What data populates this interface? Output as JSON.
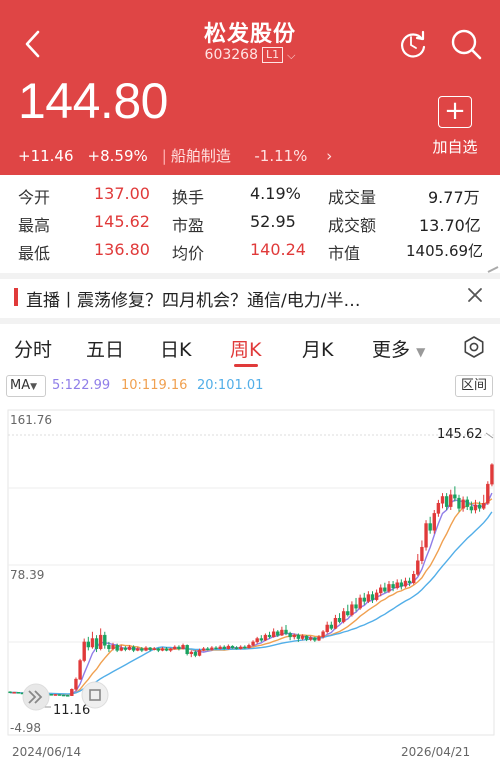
{
  "header": {
    "name": "松发股份",
    "code": "603268",
    "level": "L1",
    "price": "144.80",
    "change": "+11.46",
    "change_pct": "+8.59%",
    "sector": "船舶制造",
    "sector_change": "-1.11%",
    "add_fav_label": "加自选"
  },
  "stats": {
    "rows": [
      [
        {
          "l": "今开",
          "v": "137.00"
        },
        {
          "l": "换手",
          "v": "4.19%"
        },
        {
          "l": "成交量",
          "v": "9.77万"
        }
      ],
      [
        {
          "l": "最高",
          "v": "145.62"
        },
        {
          "l": "市盈",
          "v": "52.95"
        },
        {
          "l": "成交额",
          "v": "13.70亿"
        }
      ],
      [
        {
          "l": "最低",
          "v": "136.80"
        },
        {
          "l": "均价",
          "v": "140.24"
        },
        {
          "l": "市值",
          "v": "1405.69亿"
        }
      ]
    ]
  },
  "news": {
    "text": "直播丨震荡修复？四月机会？通信/电力/半…"
  },
  "tabs": [
    "分时",
    "五日",
    "日K",
    "周K",
    "月K",
    "更多"
  ],
  "active_tab": "周K",
  "ma": {
    "label": "MA",
    "ma5": "5:122.99",
    "ma10": "10:119.16",
    "ma20": "20:101.01",
    "range_label": "区间"
  },
  "colors": {
    "brand": "#df4545",
    "up": "#e03a3a",
    "down": "#1aa260",
    "ma5": "#8f7ee8",
    "ma10": "#f0a050",
    "ma20": "#52aee8"
  },
  "chart_data": {
    "type": "candlestick",
    "y_top_label": "161.76",
    "y_mid_label": "78.39",
    "y_bottom_label": "-4.98",
    "ylim": [
      -4.98,
      161.76
    ],
    "high_label": "145.62",
    "low_label": "11.16",
    "x_start": "2024/06/14",
    "x_end": "2026/04/21",
    "candles": [
      [
        10.5,
        10.0,
        10.8,
        9.9
      ],
      [
        10.0,
        10.2,
        10.4,
        9.8
      ],
      [
        10.2,
        9.8,
        10.3,
        9.6
      ],
      [
        9.8,
        9.5,
        10.0,
        9.3
      ],
      [
        9.5,
        9.9,
        10.0,
        9.4
      ],
      [
        9.9,
        9.6,
        10.1,
        9.4
      ],
      [
        9.6,
        9.2,
        9.8,
        9.0
      ],
      [
        9.2,
        9.4,
        9.6,
        9.0
      ],
      [
        9.4,
        9.1,
        9.6,
        8.9
      ],
      [
        9.1,
        9.0,
        9.3,
        8.8
      ],
      [
        9.0,
        8.7,
        9.2,
        8.4
      ],
      [
        8.7,
        8.9,
        9.1,
        8.5
      ],
      [
        8.9,
        8.6,
        9.0,
        8.3
      ],
      [
        8.6,
        8.4,
        8.8,
        8.1
      ],
      [
        8.4,
        8.2,
        8.7,
        8.0
      ],
      [
        8.2,
        12.0,
        12.5,
        8.1
      ],
      [
        12.0,
        18.0,
        19.0,
        11.16
      ],
      [
        18.0,
        29.0,
        30.0,
        17.5
      ],
      [
        29.0,
        40.0,
        42.0,
        28.0
      ],
      [
        40.0,
        37.0,
        43.0,
        35.0
      ],
      [
        37.0,
        42.0,
        46.0,
        36.0
      ],
      [
        42.0,
        36.0,
        44.0,
        34.0
      ],
      [
        36.0,
        44.0,
        48.0,
        35.0
      ],
      [
        44.0,
        38.0,
        46.0,
        36.0
      ],
      [
        38.0,
        36.0,
        40.0,
        34.0
      ],
      [
        36.0,
        38.0,
        39.5,
        35.0
      ],
      [
        38.0,
        35.0,
        39.0,
        34.0
      ],
      [
        35.0,
        36.5,
        38.0,
        34.5
      ],
      [
        36.5,
        35.5,
        37.5,
        34.5
      ],
      [
        35.5,
        37.0,
        38.0,
        35.0
      ],
      [
        37.0,
        35.0,
        38.0,
        34.0
      ],
      [
        35.0,
        36.0,
        37.0,
        34.5
      ],
      [
        36.0,
        35.0,
        37.0,
        34.0
      ],
      [
        35.0,
        36.5,
        37.5,
        34.5
      ],
      [
        36.5,
        35.5,
        37.0,
        34.5
      ],
      [
        35.5,
        36.0,
        37.0,
        35.0
      ],
      [
        36.0,
        35.0,
        36.5,
        34.0
      ],
      [
        35.0,
        36.0,
        37.0,
        34.5
      ],
      [
        36.0,
        35.0,
        37.0,
        34.5
      ],
      [
        35.0,
        36.0,
        36.5,
        34.0
      ],
      [
        36.0,
        37.0,
        38.0,
        35.5
      ],
      [
        37.0,
        36.0,
        38.0,
        35.0
      ],
      [
        36.0,
        38.0,
        39.0,
        35.5
      ],
      [
        38.0,
        33.0,
        38.5,
        32.0
      ],
      [
        33.0,
        34.0,
        35.0,
        31.0
      ],
      [
        34.0,
        32.0,
        35.0,
        31.0
      ],
      [
        32.0,
        35.0,
        36.0,
        31.5
      ],
      [
        35.0,
        36.0,
        37.0,
        34.5
      ],
      [
        36.0,
        35.5,
        37.0,
        35.0
      ],
      [
        35.5,
        36.5,
        37.5,
        35.0
      ],
      [
        36.5,
        36.0,
        37.5,
        35.5
      ],
      [
        36.0,
        37.0,
        38.0,
        35.5
      ],
      [
        37.0,
        36.0,
        38.0,
        35.5
      ],
      [
        36.0,
        37.5,
        38.5,
        35.5
      ],
      [
        37.5,
        36.5,
        38.0,
        36.0
      ],
      [
        36.5,
        36.0,
        37.5,
        35.5
      ],
      [
        36.0,
        37.0,
        38.0,
        35.5
      ],
      [
        37.0,
        36.5,
        38.0,
        36.0
      ],
      [
        36.5,
        38.0,
        39.0,
        36.0
      ],
      [
        38.0,
        40.0,
        41.0,
        37.5
      ],
      [
        40.0,
        42.0,
        43.0,
        39.0
      ],
      [
        42.0,
        41.0,
        44.0,
        40.0
      ],
      [
        41.0,
        44.0,
        45.0,
        40.5
      ],
      [
        44.0,
        43.0,
        46.0,
        42.0
      ],
      [
        43.0,
        46.0,
        48.0,
        42.5
      ],
      [
        46.0,
        44.0,
        47.0,
        43.0
      ],
      [
        44.0,
        47.0,
        49.0,
        43.5
      ],
      [
        47.0,
        45.0,
        50.0,
        44.0
      ],
      [
        45.0,
        43.0,
        46.0,
        41.0
      ],
      [
        43.0,
        44.0,
        45.0,
        41.5
      ],
      [
        44.0,
        42.0,
        45.0,
        40.0
      ],
      [
        42.0,
        43.5,
        44.5,
        41.0
      ],
      [
        43.5,
        41.5,
        44.0,
        40.5
      ],
      [
        41.5,
        42.5,
        43.5,
        40.5
      ],
      [
        42.5,
        41.0,
        43.0,
        40.0
      ],
      [
        41.0,
        43.0,
        44.0,
        40.5
      ],
      [
        43.0,
        46.0,
        47.0,
        42.0
      ],
      [
        46.0,
        50.0,
        52.0,
        45.0
      ],
      [
        50.0,
        48.0,
        52.0,
        47.0
      ],
      [
        48.0,
        54.0,
        56.0,
        47.5
      ],
      [
        54.0,
        52.0,
        57.0,
        51.0
      ],
      [
        52.0,
        58.0,
        60.0,
        51.0
      ],
      [
        58.0,
        56.0,
        62.0,
        55.0
      ],
      [
        56.0,
        62.0,
        64.0,
        55.0
      ],
      [
        62.0,
        60.0,
        66.0,
        58.0
      ],
      [
        60.0,
        66.0,
        68.0,
        59.0
      ],
      [
        66.0,
        64.0,
        69.0,
        62.0
      ],
      [
        64.0,
        68.0,
        70.0,
        63.0
      ],
      [
        68.0,
        65.0,
        70.0,
        63.0
      ],
      [
        65.0,
        69.0,
        71.0,
        64.0
      ],
      [
        69.0,
        72.0,
        74.0,
        67.0
      ],
      [
        72.0,
        70.0,
        75.0,
        69.0
      ],
      [
        70.0,
        74.0,
        76.0,
        69.0
      ],
      [
        74.0,
        72.0,
        76.0,
        70.0
      ],
      [
        72.0,
        75.0,
        77.0,
        71.0
      ],
      [
        75.0,
        73.0,
        77.0,
        71.0
      ],
      [
        73.0,
        76.0,
        78.0,
        72.0
      ],
      [
        76.0,
        75.0,
        78.0,
        73.0
      ],
      [
        75.0,
        80.0,
        82.0,
        74.0
      ],
      [
        80.0,
        88.0,
        92.0,
        79.0
      ],
      [
        88.0,
        96.0,
        100.0,
        86.0
      ],
      [
        96.0,
        110.0,
        112.0,
        94.0
      ],
      [
        110.0,
        106.0,
        114.0,
        104.0
      ],
      [
        106.0,
        116.0,
        118.0,
        104.0
      ],
      [
        116.0,
        122.0,
        124.0,
        114.0
      ],
      [
        122.0,
        126.0,
        128.0,
        119.0
      ],
      [
        126.0,
        120.0,
        128.0,
        118.0
      ],
      [
        120.0,
        127.0,
        130.0,
        118.0
      ],
      [
        127.0,
        125.0,
        132.0,
        123.0
      ],
      [
        125.0,
        119.0,
        127.0,
        117.0
      ],
      [
        119.0,
        124.0,
        126.0,
        117.0
      ],
      [
        124.0,
        120.0,
        126.0,
        118.0
      ],
      [
        120.0,
        118.0,
        123.0,
        116.0
      ],
      [
        118.0,
        121.0,
        124.0,
        116.0
      ],
      [
        121.0,
        119.0,
        123.0,
        117.0
      ],
      [
        119.0,
        122.0,
        127.0,
        118.0
      ],
      [
        122.0,
        133.3,
        135.0,
        121.0
      ],
      [
        133.3,
        144.8,
        145.62,
        132.0
      ]
    ]
  }
}
